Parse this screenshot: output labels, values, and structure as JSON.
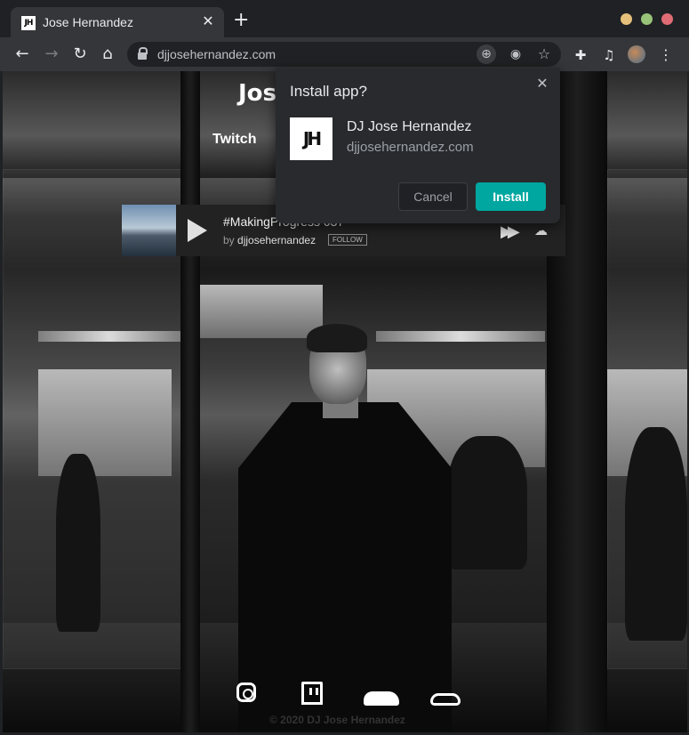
{
  "browser": {
    "tab": {
      "title": "Jose Hernandez",
      "favicon_text": "JH"
    },
    "new_tab_label": "+",
    "url": "djjosehernandez.com",
    "window_controls": [
      "minimize",
      "maximize",
      "close"
    ],
    "toolbar_icons": [
      "back-icon",
      "forward-icon",
      "reload-icon",
      "home-icon",
      "install-app-icon",
      "eye-icon",
      "star-icon",
      "puzzle-icon",
      "media-icon",
      "profile-avatar",
      "kebab-menu-icon"
    ]
  },
  "site": {
    "title": "Jos",
    "nav": {
      "twitch": "Twitch"
    },
    "player": {
      "track": "#MakingProgress 037",
      "by_label": "by",
      "user": "djjosehernandez",
      "follow": "FOLLOW"
    },
    "social": [
      "instagram-icon",
      "twitch-icon",
      "soundcloud-icon",
      "mixcloud-icon"
    ],
    "copyright": "© 2020 DJ Jose Hernandez"
  },
  "install_dialog": {
    "title": "Install app?",
    "app_icon_text": "JH",
    "app_name": "DJ Jose Hernandez",
    "app_host": "djjosehernandez.com",
    "cancel": "Cancel",
    "install": "Install",
    "install_color": "#00a6a0"
  }
}
